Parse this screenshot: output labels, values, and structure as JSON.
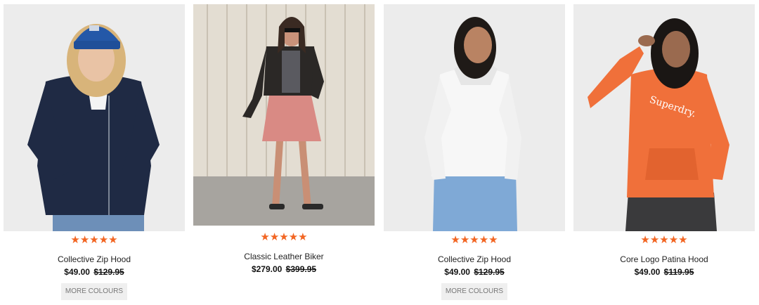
{
  "products": [
    {
      "image_alt": "Woman in navy zip hoodie and blue beanie",
      "rating_stars": 4.5,
      "stars": [
        "★",
        "★",
        "★",
        "★",
        "★"
      ],
      "name": "Collective Zip Hood",
      "price": "$49.00",
      "was_price": "$129.95",
      "more_colours": "MORE COLOURS"
    },
    {
      "image_alt": "Woman in black leather biker jacket and pink skirt",
      "rating_stars": 4.5,
      "stars": [
        "★",
        "★",
        "★",
        "★",
        "★"
      ],
      "name": "Classic Leather Biker",
      "price": "$279.00",
      "was_price": "$399.95"
    },
    {
      "image_alt": "Woman in white zip hoodie",
      "rating_stars": 4.5,
      "stars": [
        "★",
        "★",
        "★",
        "★",
        "★"
      ],
      "name": "Collective Zip Hood",
      "price": "$49.00",
      "was_price": "$129.95",
      "more_colours": "MORE COLOURS"
    },
    {
      "image_alt": "Woman in orange logo hoodie",
      "rating_stars": 5,
      "stars": [
        "★",
        "★",
        "★",
        "★",
        "★"
      ],
      "name": "Core Logo Patina Hood",
      "price": "$49.00",
      "was_price": "$119.95"
    }
  ],
  "colors": {
    "star": "#f26522",
    "button_bg": "#efefef",
    "image_bg": "#ececec"
  }
}
